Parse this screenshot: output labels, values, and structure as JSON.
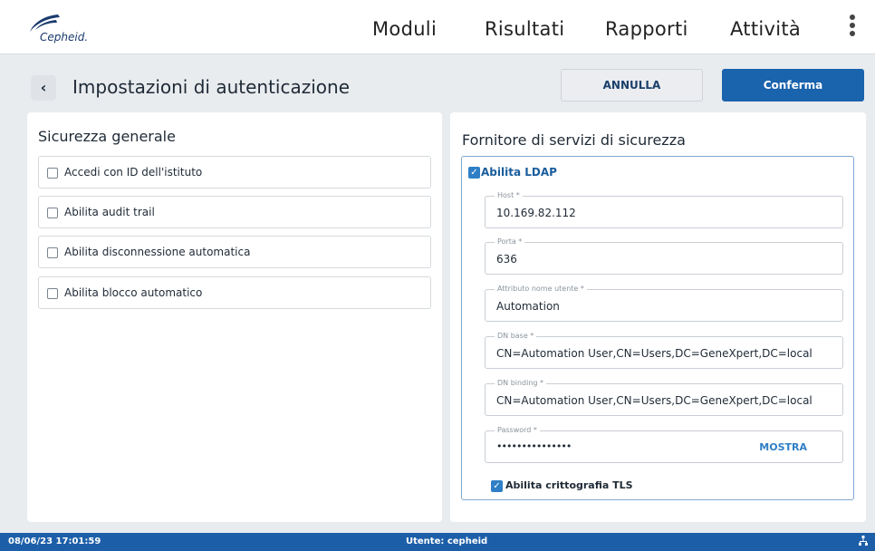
{
  "app": {
    "brand": "Cepheid."
  },
  "nav": {
    "items": [
      "Moduli",
      "Risultati",
      "Rapporti",
      "Attività"
    ]
  },
  "header": {
    "title": "Impostazioni di autenticazione",
    "cancel_label": "ANNULLA",
    "confirm_label": "Conferma"
  },
  "general": {
    "title": "Sicurezza generale",
    "options": [
      {
        "label": "Accedi con ID dell'istituto",
        "checked": false
      },
      {
        "label": "Abilita audit trail",
        "checked": false
      },
      {
        "label": "Abilita disconnessione automatica",
        "checked": false
      },
      {
        "label": "Abilita blocco automatico",
        "checked": false
      }
    ]
  },
  "provider": {
    "title": "Fornitore di servizi di sicurezza",
    "ldap_label": "Abilita LDAP",
    "ldap_enabled": true,
    "fields": [
      {
        "label": "Host *",
        "value": "10.169.82.112"
      },
      {
        "label": "Porta *",
        "value": "636"
      },
      {
        "label": "Attributo nome utente *",
        "value": "Automation"
      },
      {
        "label": "DN base *",
        "value": "CN=Automation User,CN=Users,DC=GeneXpert,DC=local"
      },
      {
        "label": "DN binding *",
        "value": "CN=Automation User,CN=Users,DC=GeneXpert,DC=local"
      }
    ],
    "password": {
      "label": "Password *",
      "value": "•••••••••••••••",
      "show_label": "MOSTRA"
    },
    "tls_label": "Abilita crittografia TLS",
    "tls_enabled": true
  },
  "status": {
    "datetime": "08/06/23 17:01:59",
    "user": "Utente: cepheid"
  },
  "colors": {
    "accent": "#1a63ad",
    "statusbar": "#1c5fa8",
    "link": "#2f7fc6"
  },
  "icons": {
    "back": "chevron-left-icon",
    "menu": "kebab-menu-icon",
    "network": "network-icon"
  }
}
